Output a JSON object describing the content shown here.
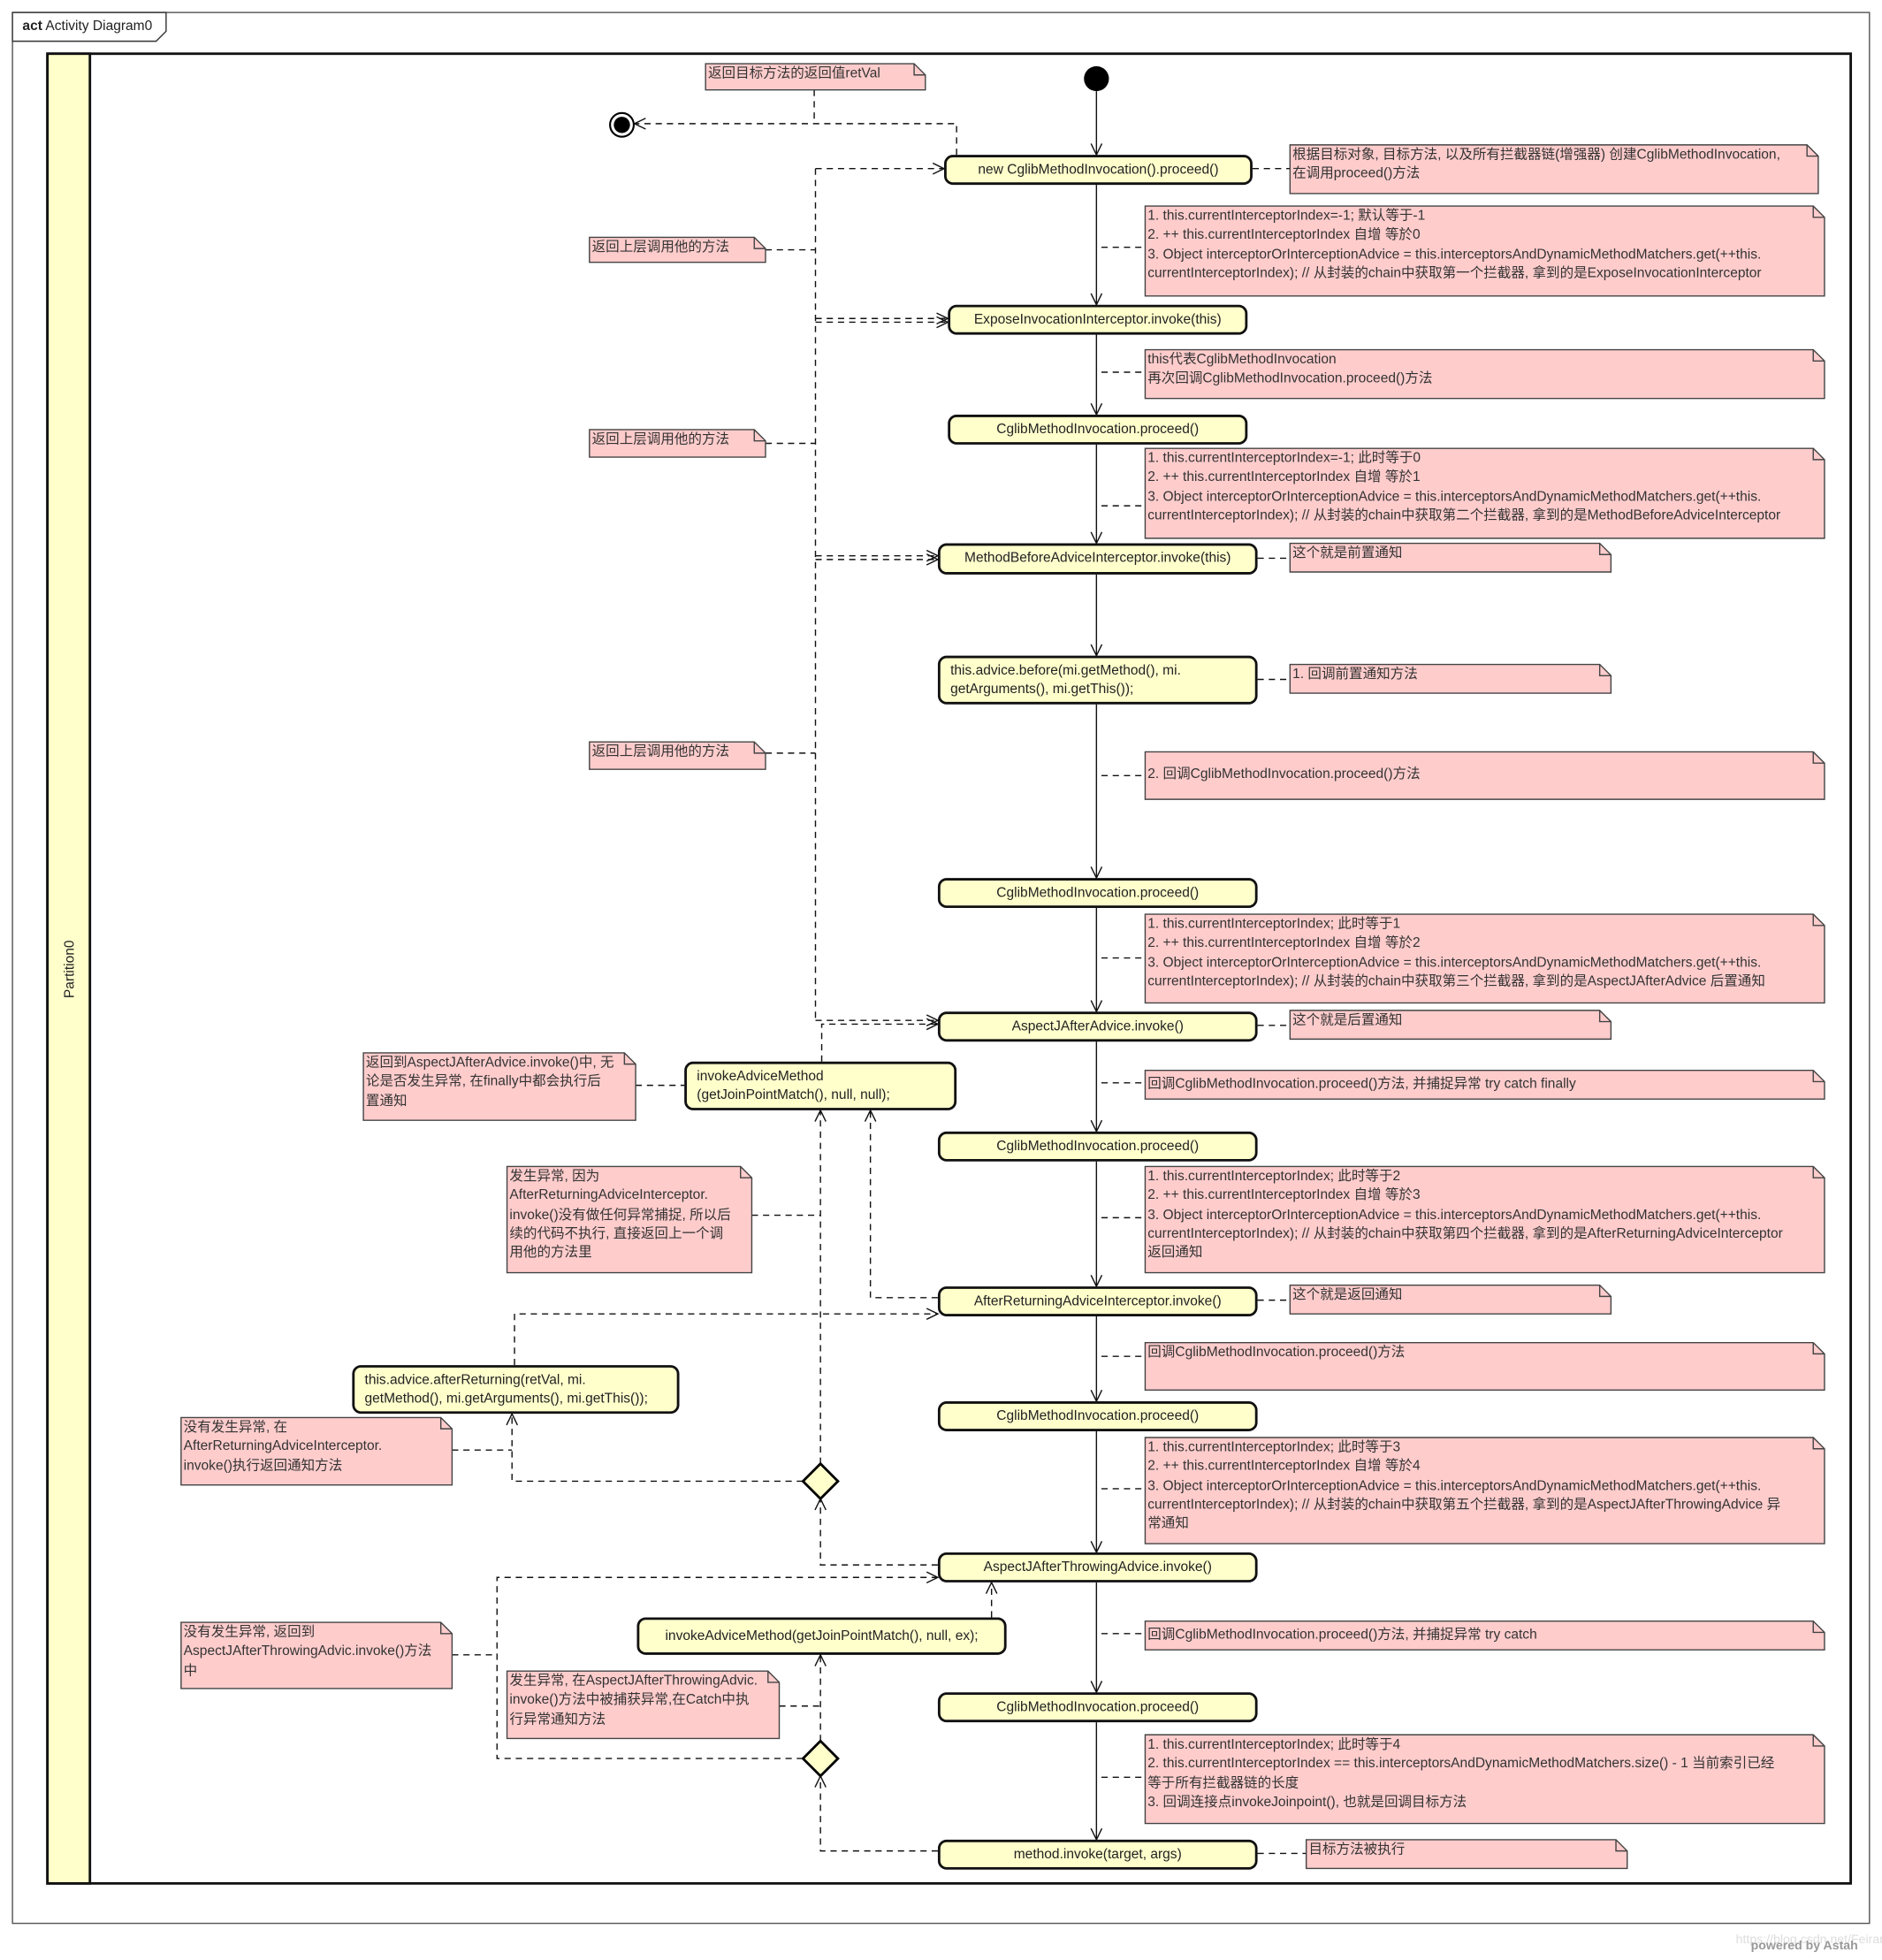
{
  "frame": {
    "keyword": "act",
    "title": "Activity Diagram0"
  },
  "partition": {
    "label": "Partition0"
  },
  "colors": {
    "action_fill": "#ffffcc",
    "note_fill": "#ffcccc",
    "lane_fill": "#ffffcc",
    "line": "#111111"
  },
  "actions": [
    {
      "label": "new CglibMethodInvocation().proceed()"
    },
    {
      "label": "ExposeInvocationInterceptor.invoke(this)"
    },
    {
      "label": "CglibMethodInvocation.proceed()"
    },
    {
      "label": "MethodBeforeAdviceInterceptor.invoke(this)"
    },
    {
      "label": "this.advice.before(mi.getMethod(), mi.\ngetArguments(), mi.getThis());"
    },
    {
      "label": "CglibMethodInvocation.proceed()"
    },
    {
      "label": "AspectJAfterAdvice.invoke()"
    },
    {
      "label": "invokeAdviceMethod\n(getJoinPointMatch(), null, null);"
    },
    {
      "label": "CglibMethodInvocation.proceed()"
    },
    {
      "label": "AfterReturningAdviceInterceptor.invoke()"
    },
    {
      "label": "this.advice.afterReturning(retVal, mi.\ngetMethod(), mi.getArguments(), mi.getThis());"
    },
    {
      "label": "CglibMethodInvocation.proceed()"
    },
    {
      "label": "AspectJAfterThrowingAdvice.invoke()"
    },
    {
      "label": "invokeAdviceMethod(getJoinPointMatch(), null, ex);"
    },
    {
      "label": "CglibMethodInvocation.proceed()"
    },
    {
      "label": "method.invoke(target, args)"
    }
  ],
  "notes": [
    {
      "text": "返回目标方法的返回值retVal"
    },
    {
      "text": "根据目标对象, 目标方法, 以及所有拦截器链(增强器) 创建CglibMethodInvocation,\n在调用proceed()方法"
    },
    {
      "text": "1. this.currentInterceptorIndex=-1; 默认等于-1\n2. ++ this.currentInterceptorIndex 自增 等於0\n3. Object interceptorOrInterceptionAdvice = this.interceptorsAndDynamicMethodMatchers.get(++this.\ncurrentInterceptorIndex);  // 从封装的chain中获取第一个拦截器, 拿到的是ExposeInvocationInterceptor"
    },
    {
      "text": "返回上层调用他的方法"
    },
    {
      "text": "this代表CglibMethodInvocation\n再次回调CglibMethodInvocation.proceed()方法"
    },
    {
      "text": "返回上层调用他的方法"
    },
    {
      "text": "1. this.currentInterceptorIndex=-1; 此时等于0\n2. ++ this.currentInterceptorIndex 自增 等於1\n3. Object interceptorOrInterceptionAdvice = this.interceptorsAndDynamicMethodMatchers.get(++this.\ncurrentInterceptorIndex);  // 从封装的chain中获取第二个拦截器, 拿到的是MethodBeforeAdviceInterceptor"
    },
    {
      "text": "这个就是前置通知"
    },
    {
      "text": "1. 回调前置通知方法"
    },
    {
      "text": "返回上层调用他的方法"
    },
    {
      "text": "2. 回调CglibMethodInvocation.proceed()方法"
    },
    {
      "text": "1. this.currentInterceptorIndex; 此时等于1\n2. ++ this.currentInterceptorIndex 自增 等於2\n3. Object interceptorOrInterceptionAdvice = this.interceptorsAndDynamicMethodMatchers.get(++this.\ncurrentInterceptorIndex);  // 从封装的chain中获取第三个拦截器, 拿到的是AspectJAfterAdvice 后置通知"
    },
    {
      "text": "这个就是后置通知"
    },
    {
      "text": "回调CglibMethodInvocation.proceed()方法, 并捕捉异常 try catch finally"
    },
    {
      "text": "返回到AspectJAfterAdvice.invoke()中, 无\n论是否发生异常, 在finally中都会执行后\n置通知"
    },
    {
      "text": "发生异常, 因为\nAfterReturningAdviceInterceptor.\ninvoke()没有做任何异常捕捉, 所以后\n续的代码不执行, 直接返回上一个调\n用他的方法里"
    },
    {
      "text": "1. this.currentInterceptorIndex; 此时等于2\n2. ++ this.currentInterceptorIndex 自增 等於3\n3. Object interceptorOrInterceptionAdvice = this.interceptorsAndDynamicMethodMatchers.get(++this.\ncurrentInterceptorIndex);  // 从封装的chain中获取第四个拦截器, 拿到的是AfterReturningAdviceInterceptor\n返回通知"
    },
    {
      "text": "这个就是返回通知"
    },
    {
      "text": "回调CglibMethodInvocation.proceed()方法"
    },
    {
      "text": "没有发生异常, 在\nAfterReturningAdviceInterceptor.\ninvoke()执行返回通知方法"
    },
    {
      "text": "1. this.currentInterceptorIndex; 此时等于3\n2. ++ this.currentInterceptorIndex 自增 等於4\n3. Object interceptorOrInterceptionAdvice = this.interceptorsAndDynamicMethodMatchers.get(++this.\ncurrentInterceptorIndex);  // 从封装的chain中获取第五个拦截器, 拿到的是AspectJAfterThrowingAdvice 异\n常通知"
    },
    {
      "text": "回调CglibMethodInvocation.proceed()方法, 并捕捉异常 try catch"
    },
    {
      "text": "没有发生异常, 返回到\nAspectJAfterThrowingAdvic.invoke()方法\n中"
    },
    {
      "text": "发生异常, 在AspectJAfterThrowingAdvic.\ninvoke()方法中被捕获异常,在Catch中执\n行异常通知方法"
    },
    {
      "text": "1. this.currentInterceptorIndex; 此时等于4\n2. this.currentInterceptorIndex == this.interceptorsAndDynamicMethodMatchers.size() - 1 当前索引已经\n等于所有拦截器链的长度\n3. 回调连接点invokeJoinpoint(), 也就是回调目标方法"
    },
    {
      "text": "目标方法被执行"
    }
  ],
  "watermark": {
    "url": "https://blog.csdn.net/Feiran",
    "brand": "powered by Astah"
  }
}
